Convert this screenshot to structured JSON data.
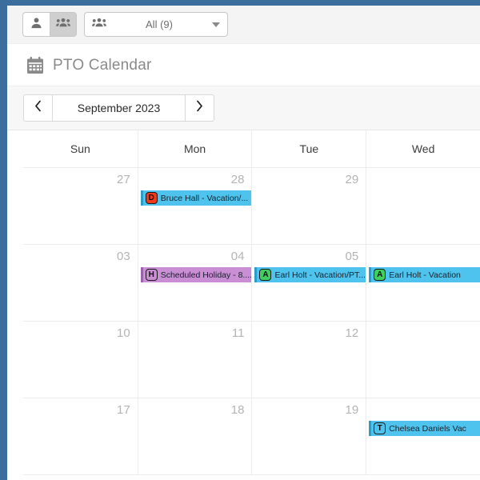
{
  "window": {
    "border_color": "#3b6e9c"
  },
  "toolbar": {
    "person_toggle": {
      "icon": "person-icon",
      "label": ""
    },
    "group_toggle": {
      "icon": "group-icon",
      "label": "",
      "selected": true
    },
    "group_filter": {
      "icon": "group-icon",
      "value": "All (9)",
      "caret_icon": "chevron-down-icon"
    }
  },
  "page": {
    "icon": "calendar-icon",
    "title": "PTO Calendar"
  },
  "month_nav": {
    "prev_label": "‹",
    "prev_icon": "chevron-left-icon",
    "current": "September 2023",
    "next_label": "›",
    "next_icon": "chevron-right-icon"
  },
  "calendar": {
    "day_headers": [
      "Sun",
      "Mon",
      "Tue",
      "Wed"
    ],
    "weeks": [
      {
        "days": [
          {
            "num": "27",
            "other_month": true,
            "events": []
          },
          {
            "num": "28",
            "other_month": true,
            "events": [
              {
                "badge": "D",
                "badge_color": "#f5391b",
                "bar_color": "#4ec3ee",
                "accent": "#2a9ec9",
                "text": "Bruce Hall - Vacation/...",
                "width": 139
              }
            ]
          },
          {
            "num": "29",
            "other_month": true,
            "events": []
          },
          {
            "num": "",
            "other_month": true,
            "events": []
          }
        ]
      },
      {
        "days": [
          {
            "num": "03",
            "other_month": false,
            "events": []
          },
          {
            "num": "04",
            "other_month": false,
            "events": [
              {
                "badge": "H",
                "badge_color": "#c98ed4",
                "bar_color": "#c98ed4",
                "accent": "#9b63ab",
                "text": "Scheduled Holiday - 8....",
                "width": 139
              }
            ]
          },
          {
            "num": "05",
            "other_month": false,
            "events": [
              {
                "badge": "A",
                "badge_color": "#3ecf5e",
                "bar_color": "#4ec3ee",
                "accent": "#2a9ec9",
                "text": "Earl Holt - Vacation/PT...",
                "width": 139
              }
            ]
          },
          {
            "num": "",
            "other_month": false,
            "events": [
              {
                "badge": "A",
                "badge_color": "#3ecf5e",
                "bar_color": "#4ec3ee",
                "accent": "#2a9ec9",
                "text": "Earl Holt - Vacation",
                "width": 139
              }
            ]
          }
        ]
      },
      {
        "days": [
          {
            "num": "10",
            "other_month": false,
            "events": []
          },
          {
            "num": "11",
            "other_month": false,
            "events": []
          },
          {
            "num": "12",
            "other_month": false,
            "events": []
          },
          {
            "num": "",
            "other_month": false,
            "events": []
          }
        ]
      },
      {
        "days": [
          {
            "num": "17",
            "other_month": false,
            "events": []
          },
          {
            "num": "18",
            "other_month": false,
            "events": []
          },
          {
            "num": "19",
            "other_month": false,
            "events": []
          },
          {
            "num": "",
            "other_month": false,
            "events": [
              {
                "badge": "T",
                "badge_color": "#4ec3ee",
                "bar_color": "#4ec3ee",
                "accent": "#2a9ec9",
                "text": "Chelsea Daniels Vac",
                "width": 139
              }
            ]
          }
        ]
      }
    ]
  }
}
